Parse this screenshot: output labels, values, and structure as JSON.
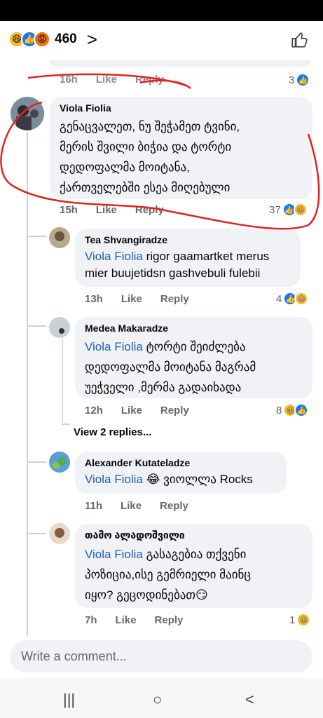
{
  "reactions_header": {
    "count": "460",
    "chevron": ">"
  },
  "prev_comment": {
    "time": "16h",
    "like": "Like",
    "reply": "Reply",
    "reaction_count": "3"
  },
  "comments": [
    {
      "author": "Viola Fiolia",
      "lines": [
        "გენაცვალეთ, ნუ შეჭამეთ ტვინი,",
        "მერის შვილი ბიჭია და ტორტი",
        "დედოფალმა მოიტანა,",
        "ქართველებში ესეა მიღებული"
      ],
      "time": "15h",
      "like": "Like",
      "reply": "Reply",
      "reaction_count": "37"
    },
    {
      "author": "Tea Shvangiradze",
      "mention": "Viola Fiolia",
      "line1_rest": " rigor gaamartket merus",
      "line2": "mier  buujetidsn gashvebuli fulebii",
      "time": "13h",
      "like": "Like",
      "reply": "Reply",
      "reaction_count": "4"
    },
    {
      "author": "Medea Makaradze",
      "mention": "Viola Fiolia",
      "line1_rest": " ტორტი შეიძლება",
      "line2": "დედოფალმა  მოიტანა  მაგრამ",
      "line3": "უეჭველი  ,მერმა  გადაიხადა",
      "time": "12h",
      "like": "Like",
      "reply": "Reply",
      "reaction_count": "8"
    },
    {
      "author": "Alexander Kutateladze",
      "mention": "Viola Fiolia",
      "line1_rest": " 😂 ვიოლლა Rocks",
      "time": "11h",
      "like": "Like",
      "reply": "Reply"
    },
    {
      "author": "თამო ალადოშვილი",
      "mention": "Viola Fiolia",
      "line1_rest": " გასაგებია თქვენი",
      "line2": "პოზიცია,ისე გემრიელი მაინც",
      "line3": "იყო? გეცოდინებათ😏",
      "time": "7h",
      "like": "Like",
      "reply": "Reply",
      "reaction_count": "1"
    }
  ],
  "view_replies": "View 2 replies...",
  "composer": {
    "placeholder": "Write a comment..."
  },
  "nav": {
    "recents": "|||",
    "home": "○",
    "back": "<"
  },
  "colors": {
    "accent": "#1877f2",
    "mention": "#1b5fb0",
    "bubble": "#f0f2f5",
    "meta": "#65676b",
    "annotation": "#e0241f"
  }
}
